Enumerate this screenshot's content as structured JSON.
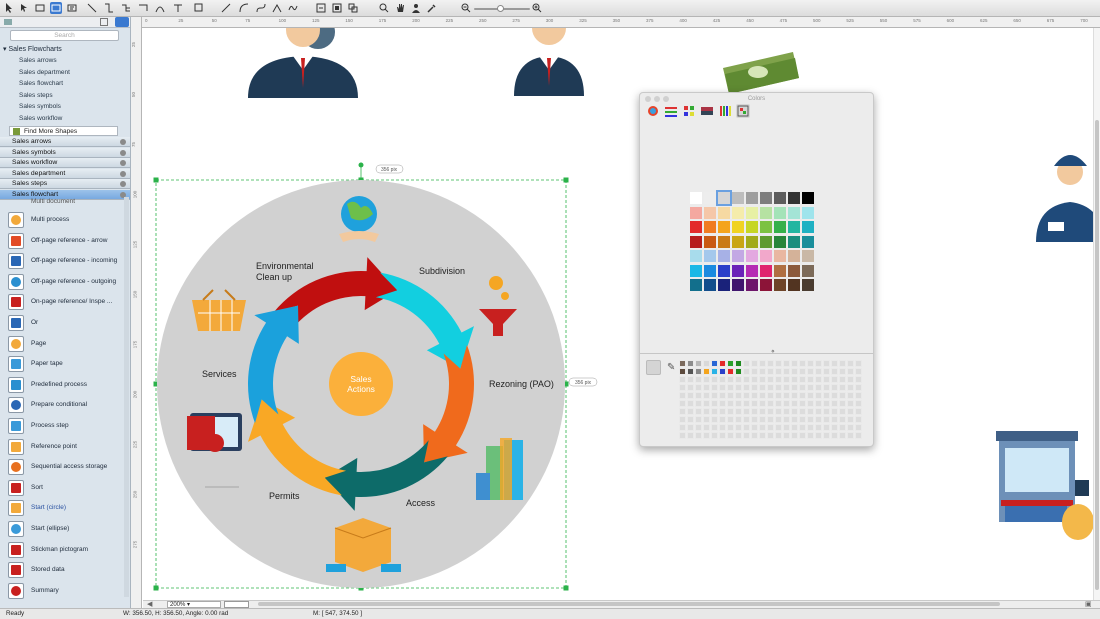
{
  "toolbar": {
    "tools": [
      "pointer-tool",
      "rectangle-tool",
      "zoom-rect-tool",
      "text-tool",
      "connector-tool",
      "smart-connector-tool",
      "tree-connector-tool",
      "chain-connector-tool",
      "curved-connector-tool",
      "split-tool",
      "line-tool",
      "arc-tool",
      "bezier-tool",
      "polyline-tool",
      "spline-tool",
      "freehand-tool",
      "zoom-fit-tool",
      "scale-tool",
      "group-tool",
      "zoom-in-tool",
      "hand-tool",
      "person-tool",
      "eyedropper-tool",
      "zoom-out-button",
      "zoom-in-button"
    ],
    "zoom_level": 0.5
  },
  "sidebar": {
    "search_placeholder": "Search",
    "library_title": "Sales Flowcharts",
    "library_items": [
      "Sales arrows",
      "Sales department",
      "Sales flowchart",
      "Sales steps",
      "Sales symbols",
      "Sales workflow"
    ],
    "find_more": "Find More Shapes",
    "categories": [
      {
        "label": "Sales arrows",
        "active": false
      },
      {
        "label": "Sales symbols",
        "active": false
      },
      {
        "label": "Sales workflow",
        "active": false
      },
      {
        "label": "Sales department",
        "active": false
      },
      {
        "label": "Sales steps",
        "active": false
      },
      {
        "label": "Sales flowchart",
        "active": true
      }
    ],
    "partial_item": "Multi document",
    "shapes": [
      {
        "label": "Multi process",
        "icon": "multi-process-icon",
        "color": "#f2a93b"
      },
      {
        "label": "Off-page reference - arrow",
        "icon": "arrow-right-icon",
        "color": "#e24b26"
      },
      {
        "label": "Off-page reference - incoming",
        "icon": "incoming-ref-icon",
        "color": "#2a67b5"
      },
      {
        "label": "Off-page reference - outgoing",
        "icon": "outgoing-ref-icon",
        "color": "#2a8fd0"
      },
      {
        "label": "On-page reference/ Inspe ...",
        "icon": "on-page-ref-icon",
        "color": "#c8201f"
      },
      {
        "label": "Or",
        "icon": "or-icon",
        "color": "#2a67b5"
      },
      {
        "label": "Page",
        "icon": "page-icon",
        "color": "#f2a93b"
      },
      {
        "label": "Paper tape",
        "icon": "paper-tape-icon",
        "color": "#3a9ad9"
      },
      {
        "label": "Predefined process",
        "icon": "predefined-process-icon",
        "color": "#2a8fd0"
      },
      {
        "label": "Prepare conditional",
        "icon": "prepare-conditional-icon",
        "color": "#2a67b5"
      },
      {
        "label": "Process step",
        "icon": "process-step-icon",
        "color": "#3a9ad9"
      },
      {
        "label": "Reference point",
        "icon": "reference-point-icon",
        "color": "#f2a93b"
      },
      {
        "label": "Sequential access storage",
        "icon": "sequential-storage-icon",
        "color": "#e8701f"
      },
      {
        "label": "Sort",
        "icon": "sort-icon",
        "color": "#c8201f"
      },
      {
        "label": "Start (circle)",
        "icon": "start-circle-icon",
        "color": "#f2a93b",
        "blue": true
      },
      {
        "label": "Start (ellipse)",
        "icon": "start-ellipse-icon",
        "color": "#3a9ad9"
      },
      {
        "label": "Stickman pictogram",
        "icon": "stickman-icon",
        "color": "#c8201f"
      },
      {
        "label": "Stored data",
        "icon": "stored-data-icon",
        "color": "#c8201f"
      },
      {
        "label": "Summary",
        "icon": "summary-icon",
        "color": "#c8201f"
      }
    ]
  },
  "ruler": {
    "ticks": [
      "0",
      "25",
      "50",
      "75",
      "100",
      "125",
      "150",
      "175",
      "200",
      "225",
      "250",
      "275",
      "300",
      "325",
      "350",
      "375",
      "400",
      "425",
      "450",
      "475",
      "500",
      "525",
      "550",
      "575",
      "600",
      "625",
      "650",
      "675",
      "700"
    ],
    "vticks": [
      "25",
      "50",
      "75",
      "100",
      "125",
      "150",
      "175",
      "200",
      "225",
      "250",
      "275"
    ],
    "unit_label": "pix"
  },
  "diagram": {
    "center": {
      "line1": "Sales",
      "line2": "Actions"
    },
    "stages": [
      "Subdivision",
      "Rezoning (PAO)",
      "Access",
      "Permits",
      "Services"
    ],
    "env_line1": "Environmental",
    "env_line2": "Clean up",
    "dim_top": "356 pix",
    "dim_right": "356 pix",
    "arrow_colors": [
      "#c00f0f",
      "#12cfe0",
      "#f06a1c",
      "#0d6b69",
      "#f9a825",
      "#1ba1dc"
    ],
    "circle_color": "#d1d1d1",
    "center_color": "#fbb03b"
  },
  "colors_panel": {
    "title": "Colors",
    "tabs": [
      "color-wheel-tab",
      "color-sliders-tab",
      "color-palettes-tab",
      "image-palettes-tab",
      "crayons-tab",
      "pencils-tab"
    ],
    "grid": [
      [
        "#ffffff",
        "#ededed",
        "#d6d6d6",
        "#bdbdbd",
        "#9e9e9e",
        "#7d7d7d",
        "#5c5c5c",
        "#333333",
        "#000000"
      ],
      [
        "#f4a8a0",
        "#f5c7a8",
        "#f6d9a2",
        "#f5ecab",
        "#e7f0a4",
        "#b6e2a2",
        "#a4e3b8",
        "#a4e4d6",
        "#9fe4ec"
      ],
      [
        "#e32a2a",
        "#f07c22",
        "#f4a41c",
        "#f0d321",
        "#c6d625",
        "#7cc242",
        "#35b04a",
        "#23b6a1",
        "#1fb1c3"
      ],
      [
        "#b71c1c",
        "#c95a14",
        "#c97a16",
        "#c9a615",
        "#a1ab1b",
        "#5e9b2f",
        "#27853a",
        "#1b8e7e",
        "#198e9b"
      ],
      [
        "#a8dcec",
        "#a4c8ec",
        "#a7b1e6",
        "#c3a8e4",
        "#e3a8e0",
        "#f2a8cb",
        "#e9b7a1",
        "#d4b299",
        "#c9b8a6"
      ],
      [
        "#1ab8e6",
        "#1a8ae0",
        "#2a3fc9",
        "#6a22b8",
        "#b52ab3",
        "#e0246e",
        "#b06f41",
        "#8c5a3c",
        "#7c6a58"
      ],
      [
        "#126f8c",
        "#124e8c",
        "#1a227a",
        "#40166e",
        "#6e166b",
        "#8c1438",
        "#6e4428",
        "#523421",
        "#4a3c30"
      ]
    ],
    "palette_row1": [
      "#7b6a5d",
      "#8c8c8c",
      "#b8b8b8",
      "#d9d9d9",
      "#2a67d5",
      "#e32a2a",
      "#2aa12a",
      "#1f8a1f"
    ],
    "palette_row2": [
      "#5c4a3d",
      "#555555",
      "#888888",
      "#f4a41c",
      "#2ab3e6",
      "#2a3fc9",
      "#e32a2a",
      "#1f8a1f"
    ]
  },
  "status": {
    "ready": "Ready",
    "dims": "W: 356.50,  H: 356.50,  Angle: 0.00 rad",
    "mouse": "M: [ 547, 374.50 ]",
    "zoom": "200%"
  }
}
